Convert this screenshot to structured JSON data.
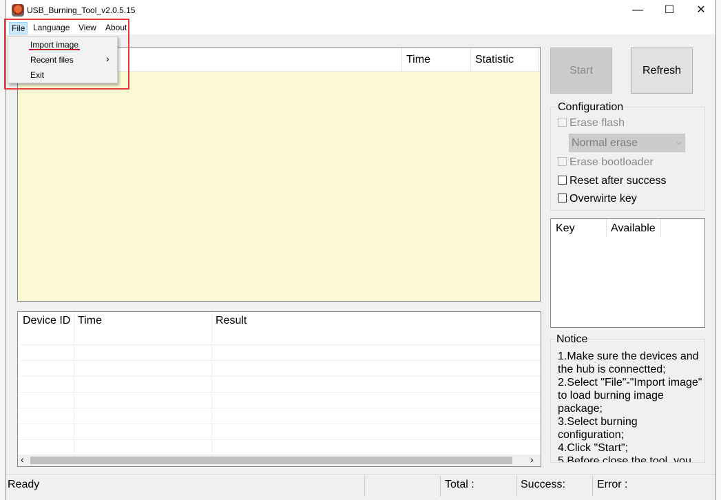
{
  "window": {
    "title": "USB_Burning_Tool_v2.0.5.15",
    "minimize_glyph": "—",
    "maximize_glyph": "☐",
    "close_glyph": "✕"
  },
  "menubar": {
    "file": "File",
    "language": "Language",
    "view": "View",
    "about": "About"
  },
  "file_menu": {
    "import_image": "Import image",
    "recent_files": "Recent files",
    "exit": "Exit",
    "submenu_arrow": "›"
  },
  "top_list": {
    "columns": [
      "Time",
      "Statistic"
    ]
  },
  "bottom_list": {
    "columns": [
      "Device ID",
      "Time",
      "Result"
    ],
    "scroll_left": "‹",
    "scroll_right": "›"
  },
  "buttons": {
    "start": "Start",
    "refresh": "Refresh"
  },
  "configuration": {
    "title": "Configuration",
    "erase_flash": "Erase flash",
    "erase_mode": "Normal erase",
    "erase_bootloader": "Erase bootloader",
    "reset_after_success": "Reset after success",
    "overwrite_key": "Overwirte key"
  },
  "key_list": {
    "columns": [
      "Key",
      "Available"
    ]
  },
  "notice": {
    "title": "Notice",
    "lines": [
      "1.Make sure the devices and the hub is connectted;",
      "2.Select \"File\"-\"Import image\" to load burning image package;",
      "3.Select burning configuration;",
      "4.Click \"Start\";",
      "5.Before close the tool, you"
    ]
  },
  "statusbar": {
    "status": "Ready",
    "total": "Total :",
    "success": "Success:",
    "error": "Error :"
  },
  "colors": {
    "highlight_box": "#e83c3c",
    "list_background": "#fbf9d4",
    "menu_selected": "#cce8ff"
  }
}
